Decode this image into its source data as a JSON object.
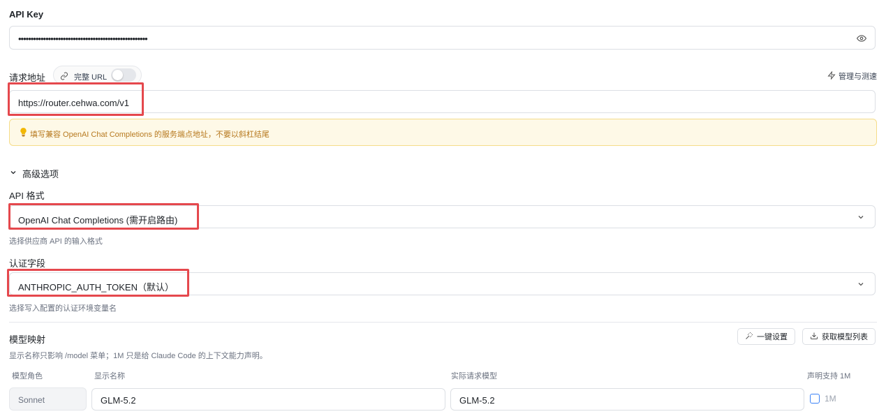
{
  "api_key": {
    "label": "API Key",
    "value": "••••••••••••••••••••••••••••••••••••••••••••••••••••"
  },
  "endpoint": {
    "label": "请求地址",
    "full_url_toggle_label": "完整 URL",
    "manage_link": "管理与测速",
    "value": "https://router.cehwa.com/v1",
    "notice": "填写兼容 OpenAI Chat Completions 的服务端点地址，不要以斜杠结尾"
  },
  "advanced": {
    "toggle_label": "高级选项",
    "api_format": {
      "label": "API 格式",
      "value": "OpenAI Chat Completions (需开启路由)",
      "hint": "选择供应商 API 的输入格式"
    },
    "auth_field": {
      "label": "认证字段",
      "value": "ANTHROPIC_AUTH_TOKEN（默认）",
      "hint": "选择写入配置的认证环境变量名"
    }
  },
  "model_mapping": {
    "title": "模型映射",
    "hint": "显示名称只影响 /model 菜单；1M 只是给 Claude Code 的上下文能力声明。",
    "one_click_button": "一键设置",
    "fetch_models_button": "获取模型列表",
    "columns": [
      "模型角色",
      "显示名称",
      "实际请求模型",
      "声明支持 1M"
    ],
    "rows": [
      {
        "role": "Sonnet",
        "display_name": "GLM-5.2",
        "actual_model": "GLM-5.2",
        "support_1m_label": "1M"
      }
    ]
  },
  "colors": {
    "highlight_red": "#e5484d",
    "notice_bg": "#fef9e7",
    "notice_border": "#f5dc8a",
    "notice_text": "#b7791f",
    "checkbox_blue": "#3b82f6"
  }
}
